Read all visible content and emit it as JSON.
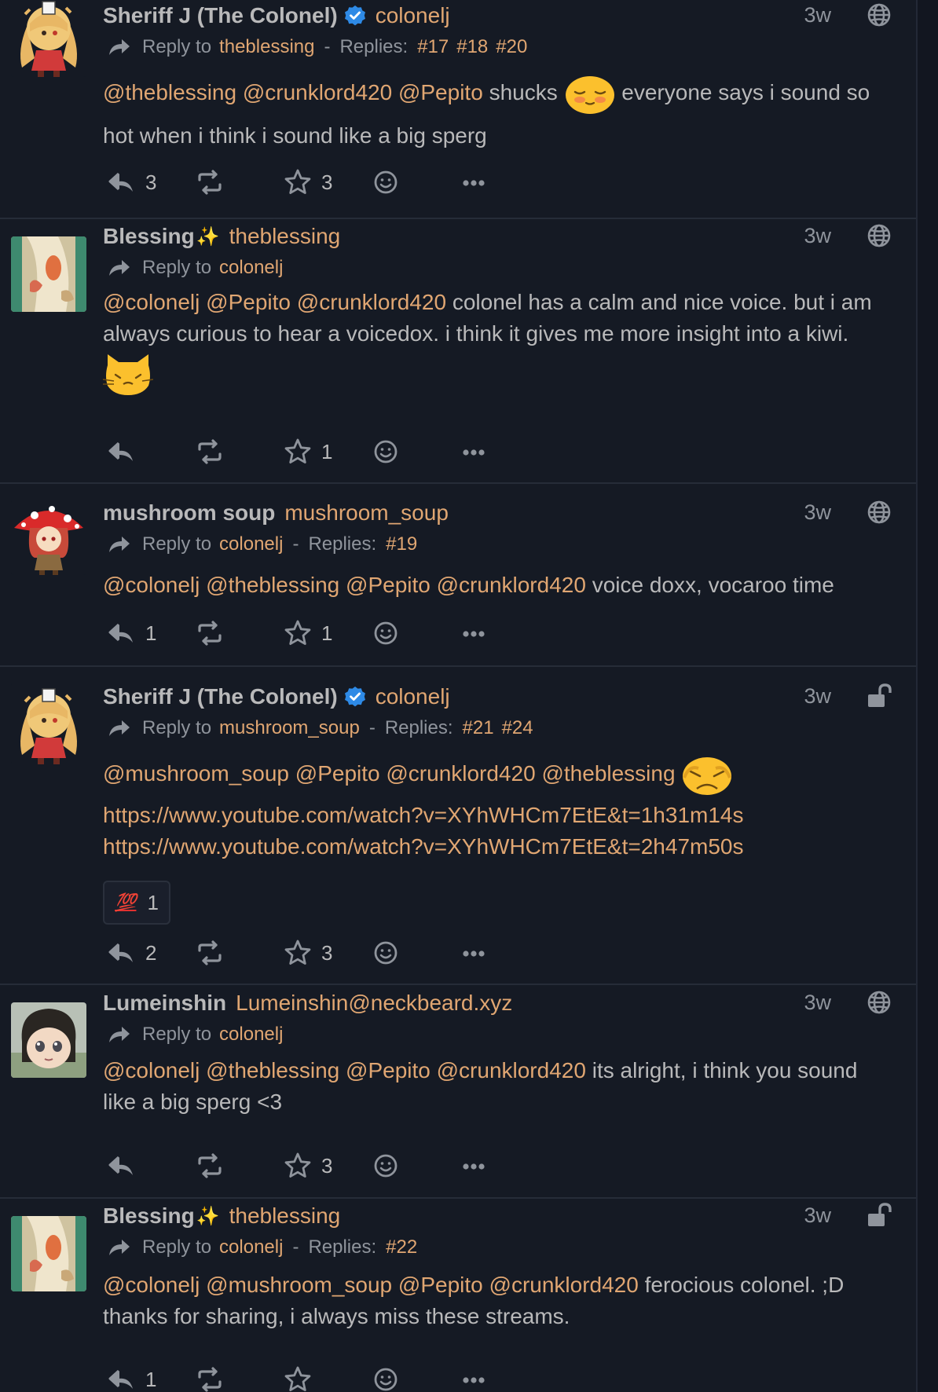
{
  "colors": {
    "background": "#151a24",
    "text": "#b9b9ba",
    "link": "#e0a672",
    "muted": "#8f949c",
    "verified": "#2e8ae6"
  },
  "labels": {
    "reply_to": "Reply to",
    "replies": "Replies:",
    "separator": "-"
  },
  "posts": [
    {
      "name": "Sheriff J (The Colonel)",
      "handle": "colonelj",
      "time": "3w",
      "scope_icon": "globe-icon",
      "reply_to": "theblessing",
      "replies": [
        "#17",
        "#18",
        "#20"
      ],
      "mentions": [
        "@theblessing",
        "@crunklord420",
        "@Pepito"
      ],
      "text_a": "shucks",
      "text_b": "everyone says i sound so hot when i think i sound like a big sperg",
      "inline_emoji": "blush-emoji",
      "counts": {
        "replies": "3",
        "favorites": "3"
      }
    },
    {
      "name": "Blessing",
      "name_emoji": "✨",
      "handle": "theblessing",
      "time": "3w",
      "scope_icon": "globe-icon",
      "reply_to": "colonelj",
      "mentions": [
        "@colonelj",
        "@Pepito",
        "@crunklord420"
      ],
      "text_a": "colonel has a calm and nice voice. but i am always curious to hear a voicedox. i think it gives me more insight into a kiwi.",
      "inline_emoji": "cat-listening-emoji",
      "counts": {
        "replies": "",
        "favorites": "1"
      }
    },
    {
      "name": "mushroom soup",
      "handle": "mushroom_soup",
      "time": "3w",
      "scope_icon": "globe-icon",
      "reply_to": "colonelj",
      "replies": [
        "#19"
      ],
      "mentions": [
        "@colonelj",
        "@theblessing",
        "@Pepito",
        "@crunklord420"
      ],
      "text_a": "voice doxx, vocaroo time",
      "counts": {
        "replies": "1",
        "favorites": "1"
      }
    },
    {
      "name": "Sheriff J (The Colonel)",
      "handle": "colonelj",
      "time": "3w",
      "scope_icon": "unlock-icon",
      "reply_to": "mushroom_soup",
      "replies": [
        "#21",
        "#24"
      ],
      "mentions": [
        "@mushroom_soup",
        "@Pepito",
        "@crunklord420",
        "@theblessing"
      ],
      "inline_emoji": "facepalm-emoji",
      "links": [
        "https://www.youtube.com/watch?v=XYhWHCm7EtE&t=1h31m14s",
        "https://www.youtube.com/watch?v=XYhWHCm7EtE&t=2h47m50s"
      ],
      "reaction": {
        "emoji": "💯",
        "count": "1"
      },
      "counts": {
        "replies": "2",
        "favorites": "3"
      }
    },
    {
      "name": "Lumeinshin",
      "handle": "Lumeinshin@neckbeard.xyz",
      "time": "3w",
      "scope_icon": "globe-icon",
      "reply_to": "colonelj",
      "mentions": [
        "@colonelj",
        "@theblessing",
        "@Pepito",
        "@crunklord420"
      ],
      "text_a": "its alright, i think you sound like a big sperg <3",
      "counts": {
        "replies": "",
        "favorites": "3"
      }
    },
    {
      "name": "Blessing",
      "name_emoji": "✨",
      "handle": "theblessing",
      "time": "3w",
      "scope_icon": "unlock-icon",
      "reply_to": "colonelj",
      "replies": [
        "#22"
      ],
      "mentions": [
        "@colonelj",
        "@mushroom_soup",
        "@Pepito",
        "@crunklord420"
      ],
      "text_a": "ferocious colonel. ;D thanks for sharing, i always miss these streams.",
      "counts": {
        "replies": "1",
        "favorites": ""
      }
    }
  ]
}
